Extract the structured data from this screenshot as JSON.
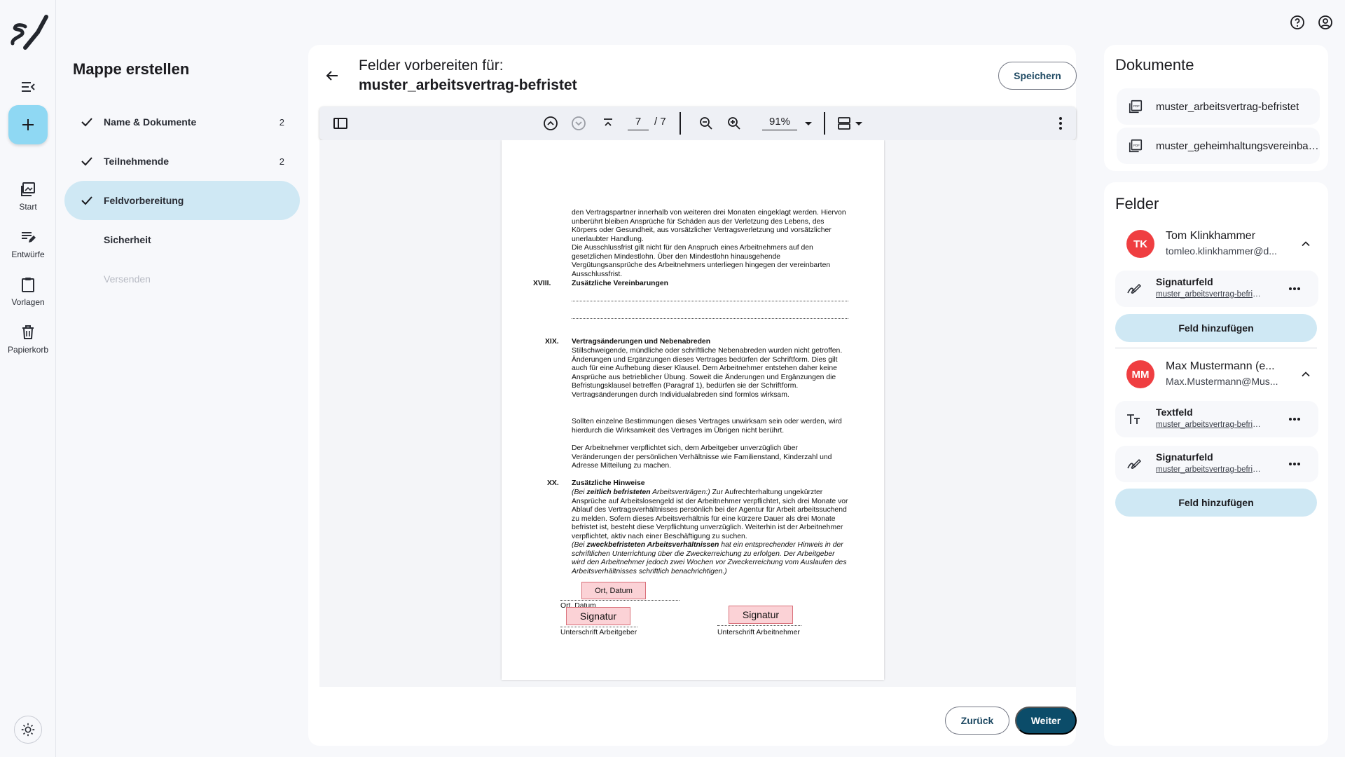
{
  "rail": {
    "items": [
      {
        "label": "Start",
        "icon": "start-icon"
      },
      {
        "label": "Entwürfe",
        "icon": "drafts-icon"
      },
      {
        "label": "Vorlagen",
        "icon": "templates-icon"
      },
      {
        "label": "Papierkorb",
        "icon": "trash-icon"
      }
    ]
  },
  "steps": {
    "title": "Mappe erstellen",
    "items": [
      {
        "label": "Name & Dokumente",
        "count": "2",
        "done": true
      },
      {
        "label": "Teilnehmende",
        "count": "2",
        "done": true
      },
      {
        "label": "Feldvorbereitung",
        "count": "",
        "done": true,
        "active": true
      },
      {
        "label": "Sicherheit",
        "count": "",
        "done": false
      },
      {
        "label": "Versenden",
        "count": "",
        "done": false,
        "disabled": true
      }
    ]
  },
  "main": {
    "title_line1": "Felder vorbereiten für:",
    "title_line2": "muster_arbeitsvertrag-befristet",
    "save_label": "Speichern",
    "back_label": "Zurück",
    "next_label": "Weiter"
  },
  "toolbar": {
    "page_current": "7",
    "page_total": "/ 7",
    "zoom": "91%"
  },
  "document": {
    "para1": "den Vertragspartner innerhalb von weiteren drei Monaten eingeklagt werden. Hiervon unberührt bleiben Ansprüche für Schäden aus der Verletzung des Lebens, des Körpers oder Gesundheit, aus vorsätzlicher Vertragsverletzung und vorsätzlicher unerlaubter Handlung.",
    "para2": "Die Ausschlussfrist gilt nicht für den Anspruch eines Arbeitnehmers auf den gesetzlichen Mindestlohn. Über den Mindestlohn hinausgehende Vergütungsansprüche des Arbeitnehmers unterliegen hingegen der vereinbarten Ausschlussfrist.",
    "sec18_no": "XVIII.",
    "sec18_head": "Zusätzliche Vereinbarungen",
    "sec19_no": "XIX.",
    "sec19_head": "Vertragsänderungen und Nebenabreden",
    "sec19_p1": "Stillschweigende, mündliche oder schriftliche Nebenabreden wurden nicht getroffen. Änderungen und Ergänzungen dieses Vertrages bedürfen der Schriftform. Dies gilt auch für eine Aufhebung dieser Klausel. Dem Arbeitnehmer entstehen daher keine Ansprüche aus betrieblicher Übung. Soweit die Änderungen und Ergänzungen die Befristungsklausel betreffen (Paragraf 1), bedürfen sie der Schriftform. Vertragsänderungen durch Individualabreden sind formlos wirksam.",
    "sec19_p2": "Sollten einzelne Bestimmungen dieses Vertrages unwirksam sein oder werden, wird hierdurch die Wirksamkeit des Vertrages im Übrigen nicht berührt.",
    "sec19_p3": "Der Arbeitnehmer verpflichtet sich, dem Arbeitgeber unverzüglich über Veränderungen der persönlichen Verhältnisse wie Familienstand, Kinderzahl und Adresse Mitteilung zu machen.",
    "sec20_no": "XX.",
    "sec20_head": "Zusätzliche Hinweise",
    "sec20_p1_a": "(Bei ",
    "sec20_p1_b": "zeitlich befristeten",
    "sec20_p1_c": " Arbeitsverträgen:)",
    "sec20_p1_d": " Zur Aufrechterhaltung ungekürzter Ansprüche auf Arbeitslosengeld ist der Arbeitnehmer verpflichtet, sich drei Monate vor Ablauf des Vertragsverhältnisses persönlich bei der Agentur für Arbeit arbeitssuchend zu melden. Sofern dieses Arbeitsverhältnis für eine kürzere Dauer als drei Monate befristet ist, besteht diese Verpflichtung unverzüglich. Weiterhin ist der Arbeitnehmer verpflichtet, aktiv nach einer Beschäftigung zu suchen.",
    "sec20_p2_a": "(Bei ",
    "sec20_p2_b": "zweckbefristeten Arbeitsverhältnissen",
    "sec20_p2_c": " hat ein entsprechender Hinweis in der schriftlichen Unterrichtung über die Zweckerreichung zu erfolgen. Der Arbeitgeber wird den Arbeitnehmer jedoch zwei Wochen vor Zweckerreichung vom Auslaufen des Arbeitsverhältnisses schriftlich benachrichtigen.)",
    "field_ort": "Ort, Datum",
    "caption_ort": "Ort, Datum",
    "field_sig1": "Signatur",
    "field_sig2": "Signatur",
    "caption_employer": "Unterschrift Arbeitgeber",
    "caption_employee": "Unterschrift Arbeitnehmer"
  },
  "documents": {
    "title": "Dokumente",
    "items": [
      "muster_arbeitsvertrag-befristet",
      "muster_geheimhaltungsvereinbarung"
    ]
  },
  "fields": {
    "title": "Felder",
    "people": [
      {
        "initials": "TK",
        "name": "Tom Klinkhammer",
        "email": "tomleo.klinkhammer@d...",
        "fields": [
          {
            "name": "Signaturfeld",
            "doc": "muster_arbeitsvertrag-befristet",
            "icon": "signature-icon"
          }
        ],
        "add_label": "Feld hinzufügen"
      },
      {
        "initials": "MM",
        "name": "Max Mustermann (e...",
        "email": "Max.Mustermann@Mus...",
        "fields": [
          {
            "name": "Textfeld",
            "doc": "muster_arbeitsvertrag-befristet",
            "icon": "text-field-icon"
          },
          {
            "name": "Signaturfeld",
            "doc": "muster_arbeitsvertrag-befristet",
            "icon": "signature-icon"
          }
        ],
        "add_label": "Feld hinzufügen"
      }
    ]
  },
  "colors": {
    "accent": "#0b4c69",
    "active_step": "#cfe8f4",
    "fab": "#8fd8f3",
    "avatar": "#ef3e41",
    "signature_field": "#fbd2d6"
  }
}
